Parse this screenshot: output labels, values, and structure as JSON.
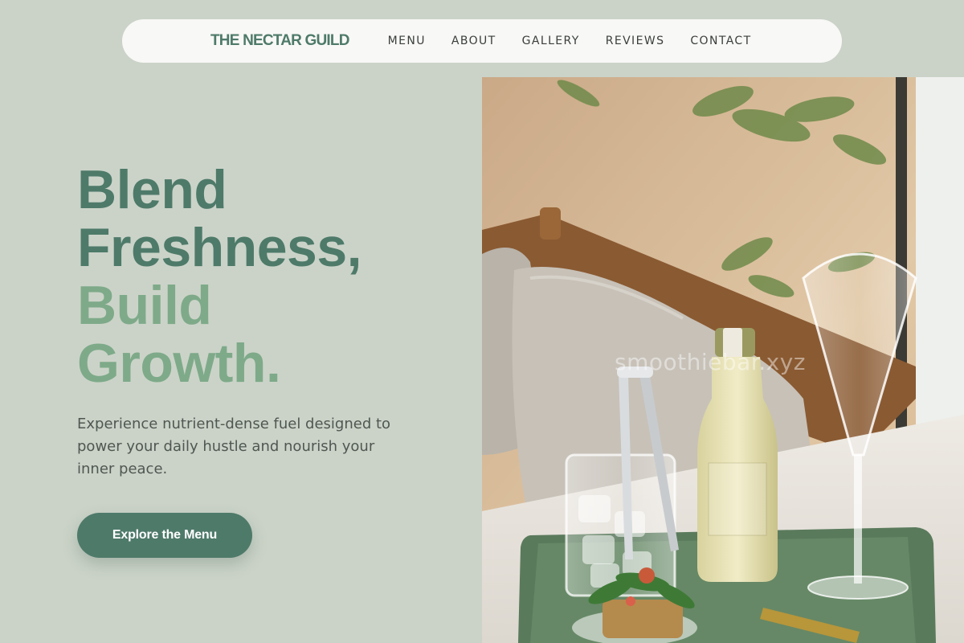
{
  "brand": "THE NECTAR GUILD",
  "nav": {
    "items": [
      {
        "label": "MENU"
      },
      {
        "label": "ABOUT"
      },
      {
        "label": "GALLERY"
      },
      {
        "label": "REVIEWS"
      },
      {
        "label": "CONTACT"
      }
    ]
  },
  "hero": {
    "headline": {
      "line1": "Blend",
      "line2": "Freshness,",
      "line3": "Build",
      "line4": "Growth."
    },
    "subtext": "Experience nutrient-dense fuel designed to power your daily hustle and nourish your inner peace.",
    "cta_label": "Explore the Menu"
  },
  "image": {
    "watermark": "smoothiebar.xyz",
    "alt": "Drinks tray with glass bottle, ice glass and champagne flute"
  },
  "colors": {
    "background": "#cbd3c8",
    "accent_dark": "#4e7a6a",
    "accent_light": "#7eaa89",
    "nav_bg": "#f8f8f6"
  }
}
